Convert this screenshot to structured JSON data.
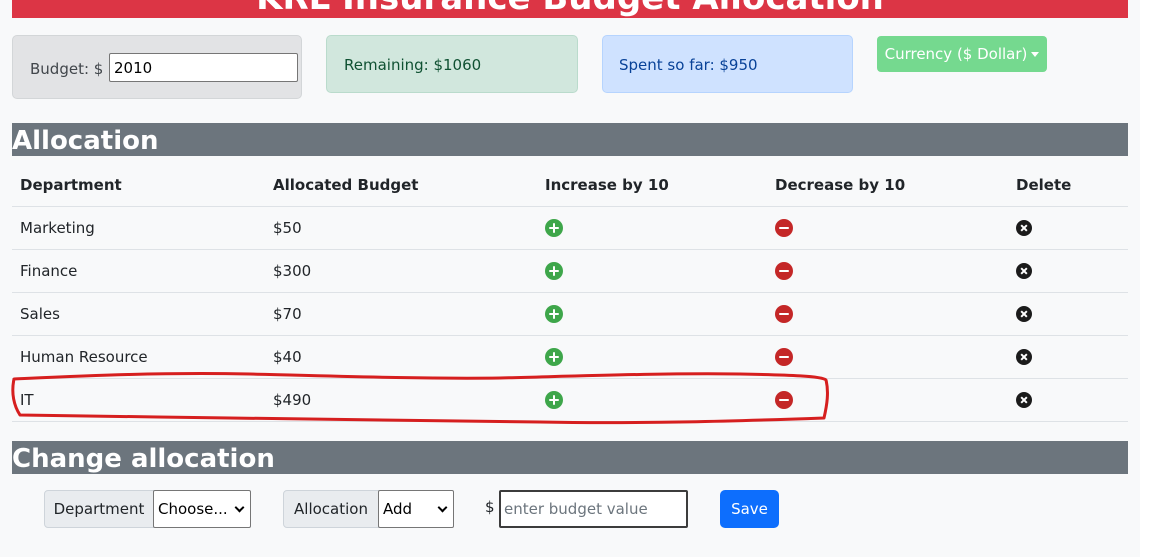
{
  "header": {
    "title": "KRL Insurance Budget Allocation"
  },
  "budget": {
    "label": "Budget: $",
    "value": "2010"
  },
  "remaining": {
    "text": "Remaining: $1060"
  },
  "spent": {
    "text": "Spent so far: $950"
  },
  "currency": {
    "label": "Currency ($ Dollar)"
  },
  "allocation": {
    "heading": "Allocation",
    "columns": [
      "Department",
      "Allocated Budget",
      "Increase by 10",
      "Decrease by 10",
      "Delete"
    ],
    "rows": [
      {
        "department": "Marketing",
        "budget": "$50"
      },
      {
        "department": "Finance",
        "budget": "$300"
      },
      {
        "department": "Sales",
        "budget": "$70"
      },
      {
        "department": "Human Resource",
        "budget": "$40"
      },
      {
        "department": "IT",
        "budget": "$490"
      }
    ]
  },
  "change": {
    "heading": "Change allocation",
    "department_label": "Department",
    "department_selected": "Choose...",
    "allocation_label": "Allocation",
    "allocation_selected": "Add",
    "currency_symbol": "$",
    "value_placeholder": "enter budget value",
    "save_label": "Save"
  },
  "colors": {
    "title_bar": "#dc3545",
    "increase_icon": "#3ea64a",
    "decrease_icon": "#c42727",
    "annotation_stroke": "#d61f1f",
    "save_button": "#0d6efd"
  },
  "icons": {
    "increase": "plus-circle-icon",
    "decrease": "minus-circle-icon",
    "delete": "x-circle-icon"
  }
}
